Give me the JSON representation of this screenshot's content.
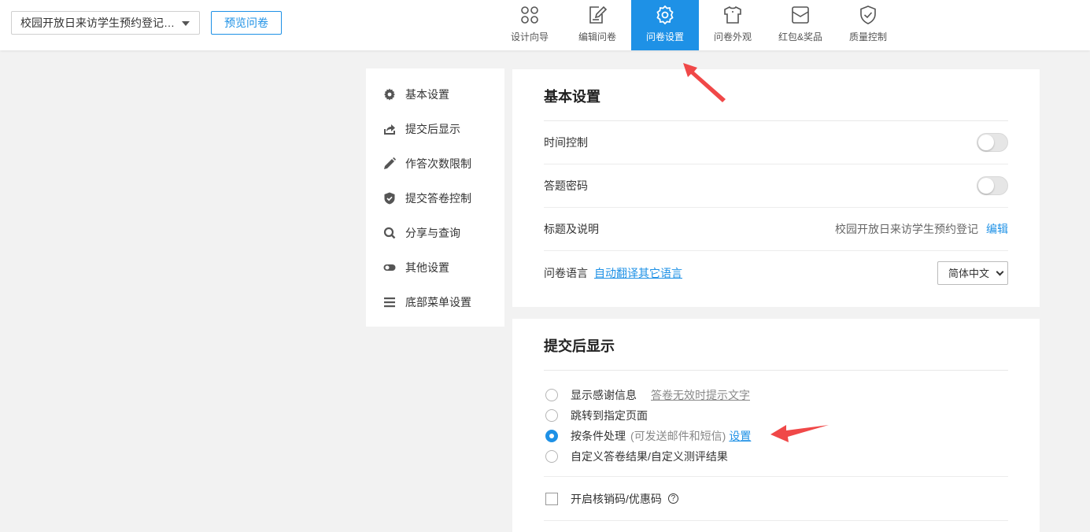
{
  "header": {
    "survey_title": "校园开放日来访学生预约登记…",
    "preview_label": "预览问卷",
    "nav": [
      {
        "label": "设计向导",
        "icon": "design-wizard-icon"
      },
      {
        "label": "编辑问卷",
        "icon": "edit-survey-icon"
      },
      {
        "label": "问卷设置",
        "icon": "survey-settings-icon",
        "active": true
      },
      {
        "label": "问卷外观",
        "icon": "appearance-shirt-icon"
      },
      {
        "label": "红包&奖品",
        "icon": "red-envelope-icon"
      },
      {
        "label": "质量控制",
        "icon": "quality-shield-icon"
      }
    ]
  },
  "sidebar": {
    "items": [
      {
        "label": "基本设置",
        "icon": "gear-icon"
      },
      {
        "label": "提交后显示",
        "icon": "share-out-icon"
      },
      {
        "label": "作答次数限制",
        "icon": "pencil-icon"
      },
      {
        "label": "提交答卷控制",
        "icon": "shield-check-icon"
      },
      {
        "label": "分享与查询",
        "icon": "search-icon"
      },
      {
        "label": "其他设置",
        "icon": "toggle-icon"
      },
      {
        "label": "底部菜单设置",
        "icon": "menu-lines-icon"
      }
    ]
  },
  "basic": {
    "title": "基本设置",
    "time_control": "时间控制",
    "password": "答题密码",
    "title_desc": "标题及说明",
    "title_value": "校园开放日来访学生预约登记",
    "edit_link": "编辑",
    "language": "问卷语言",
    "translate_link": "自动翻译其它语言",
    "language_value": "简体中文"
  },
  "after_submit": {
    "title": "提交后显示",
    "options": [
      {
        "label": "显示感谢信息",
        "extra_link": "答卷无效时提示文字",
        "checked": false
      },
      {
        "label": "跳转到指定页面",
        "checked": false
      },
      {
        "label": "按条件处理",
        "note": "(可发送邮件和短信)",
        "link": "设置",
        "checked": true
      },
      {
        "label": "自定义答卷结果/自定义测评结果",
        "checked": false
      }
    ],
    "coupon_label": "开启核销码/优惠码",
    "help_glyph": "?"
  },
  "colors": {
    "accent": "#1e91e6",
    "arrow": "#f04848",
    "background": "#f2f2f2"
  }
}
